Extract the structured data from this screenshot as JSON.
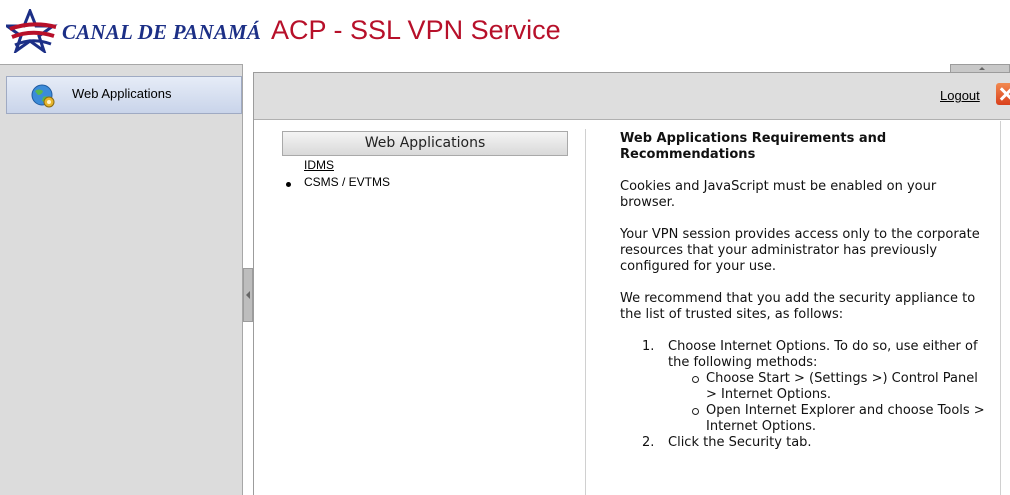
{
  "header": {
    "logo_text": "CANAL DE PANAMÁ",
    "title": "ACP - SSL VPN Service",
    "logo_icon": "star-icon",
    "brand_blue": "#1c2f86",
    "brand_red": "#b7102a"
  },
  "sidebar": {
    "items": [
      {
        "label": "Web Applications",
        "icon": "web-apps-globe-icon"
      }
    ]
  },
  "toolbar": {
    "logout_label": "Logout",
    "logout_icon": "close-icon"
  },
  "apps": {
    "header": "Web Applications",
    "items": [
      "IDMS",
      "CSMS / EVTMS"
    ]
  },
  "requirements": {
    "title": "Web Applications Requirements and Recommendations",
    "p1": "Cookies and JavaScript must be enabled on your browser.",
    "p2": "Your VPN session provides access only to the corporate resources that your administrator has previously configured for your use.",
    "p3": "We recommend that you add the security appliance to the list of trusted sites, as follows:",
    "steps": [
      {
        "num": "1.",
        "text": "Choose Internet Options. To do so, use either of the following methods:"
      },
      {
        "num": "2.",
        "text": "Click the Security tab."
      }
    ],
    "substeps": [
      "Choose Start > (Settings >) Control Panel > Internet Options.",
      "Open Internet Explorer and choose Tools > Internet Options."
    ]
  }
}
